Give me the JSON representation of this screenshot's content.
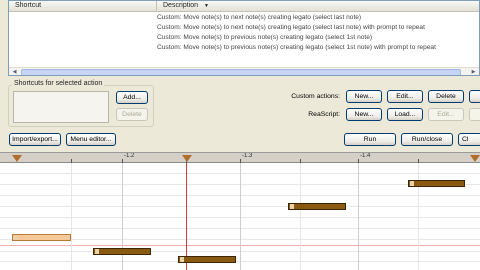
{
  "list": {
    "col_shortcut": "Shortcut",
    "col_description": "Description",
    "rows": [
      "Custom: Move note(s) to next note(s) creating legato (select last note)",
      "Custom: Move note(s) to next note(s) creating legato (select last note) with prompt to repeat",
      "Custom: Move note(s) to previous note(s) creating legato (select 1st note)",
      "Custom: Move note(s) to previous note(s) creating legato (select 1st note) with prompt to repeat"
    ]
  },
  "shortcuts": {
    "group_label": "Shortcuts for selected action",
    "add": "Add...",
    "delete": "Delete"
  },
  "custom_actions": {
    "label": "Custom actions:",
    "new": "New...",
    "edit": "Edit...",
    "delete": "Delete"
  },
  "reascript": {
    "label": "ReaScript:",
    "new": "New...",
    "load": "Load...",
    "edit": "Edit..."
  },
  "bottom": {
    "import_export": "Import/export...",
    "menu_editor": "Menu editor...",
    "run": "Run",
    "run_close": "Run/close",
    "close_partial": "Cl"
  },
  "ruler": {
    "labels": [
      "-1.2",
      "-1.3",
      "-1.4"
    ]
  },
  "colors": {
    "note_fill": "#8a5a12",
    "note_selected": "#f7c89a",
    "marker": "#b26c2b",
    "button_border": "#003c74"
  }
}
